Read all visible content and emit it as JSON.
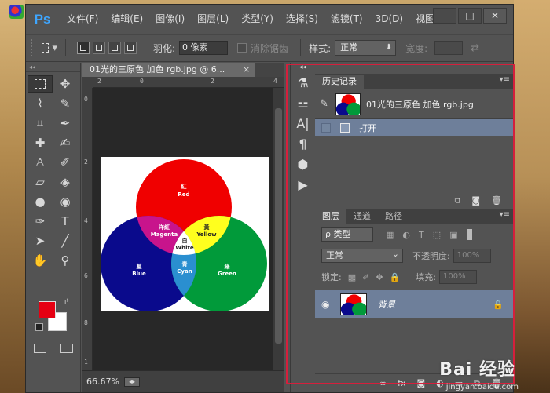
{
  "app": {
    "logo": "Ps",
    "menu": [
      "文件(F)",
      "编辑(E)",
      "图像(I)",
      "图层(L)",
      "类型(Y)",
      "选择(S)",
      "滤镜(T)",
      "3D(D)",
      "视图("
    ],
    "window_buttons": [
      "—",
      "□",
      "✕"
    ]
  },
  "options_bar": {
    "feather_label": "羽化:",
    "feather_value": "0 像素",
    "antialias_label": "消除锯齿",
    "style_label": "样式:",
    "style_value": "正常",
    "width_label": "宽度:"
  },
  "document": {
    "tab_title": "01光的三原色 加色 rgb.jpg @ 6...",
    "tab_close": "×",
    "zoom": "66.67%",
    "ruler_top": [
      "2",
      "0",
      "2",
      "4"
    ],
    "ruler_left": [
      "0",
      "2",
      "4",
      "6",
      "8",
      "1"
    ],
    "image": {
      "red_title": "紅",
      "red_label": "Red",
      "magenta_title": "洋紅",
      "magenta_label": "Magenta",
      "yellow_title": "黃",
      "yellow_label": "Yellow",
      "white_title": "白",
      "white_label": "White",
      "blue_title": "藍",
      "blue_label": "Blue",
      "cyan_title": "青",
      "cyan_label": "Cyan",
      "green_title": "綠",
      "green_label": "Green"
    }
  },
  "history_panel": {
    "tab": "历史记录",
    "snapshot_name": "01光的三原色 加色 rgb.jpg",
    "steps": [
      "打开"
    ]
  },
  "layers_panel": {
    "tabs": [
      "图层",
      "通道",
      "路径"
    ],
    "filter_label": "ρ 类型",
    "blend_mode": "正常",
    "opacity_label": "不透明度:",
    "opacity_value": "100%",
    "lock_label": "锁定:",
    "fill_label": "填充:",
    "fill_value": "100%",
    "layer_name": "背景"
  },
  "watermark": {
    "brand": "Bai 经验",
    "url": "jingyan.baidu.com"
  },
  "colors": {
    "foreground": "#e60012",
    "background": "#ffffff",
    "highlight_frame": "#d61f3c",
    "selection_row": "#6e7f9a"
  }
}
